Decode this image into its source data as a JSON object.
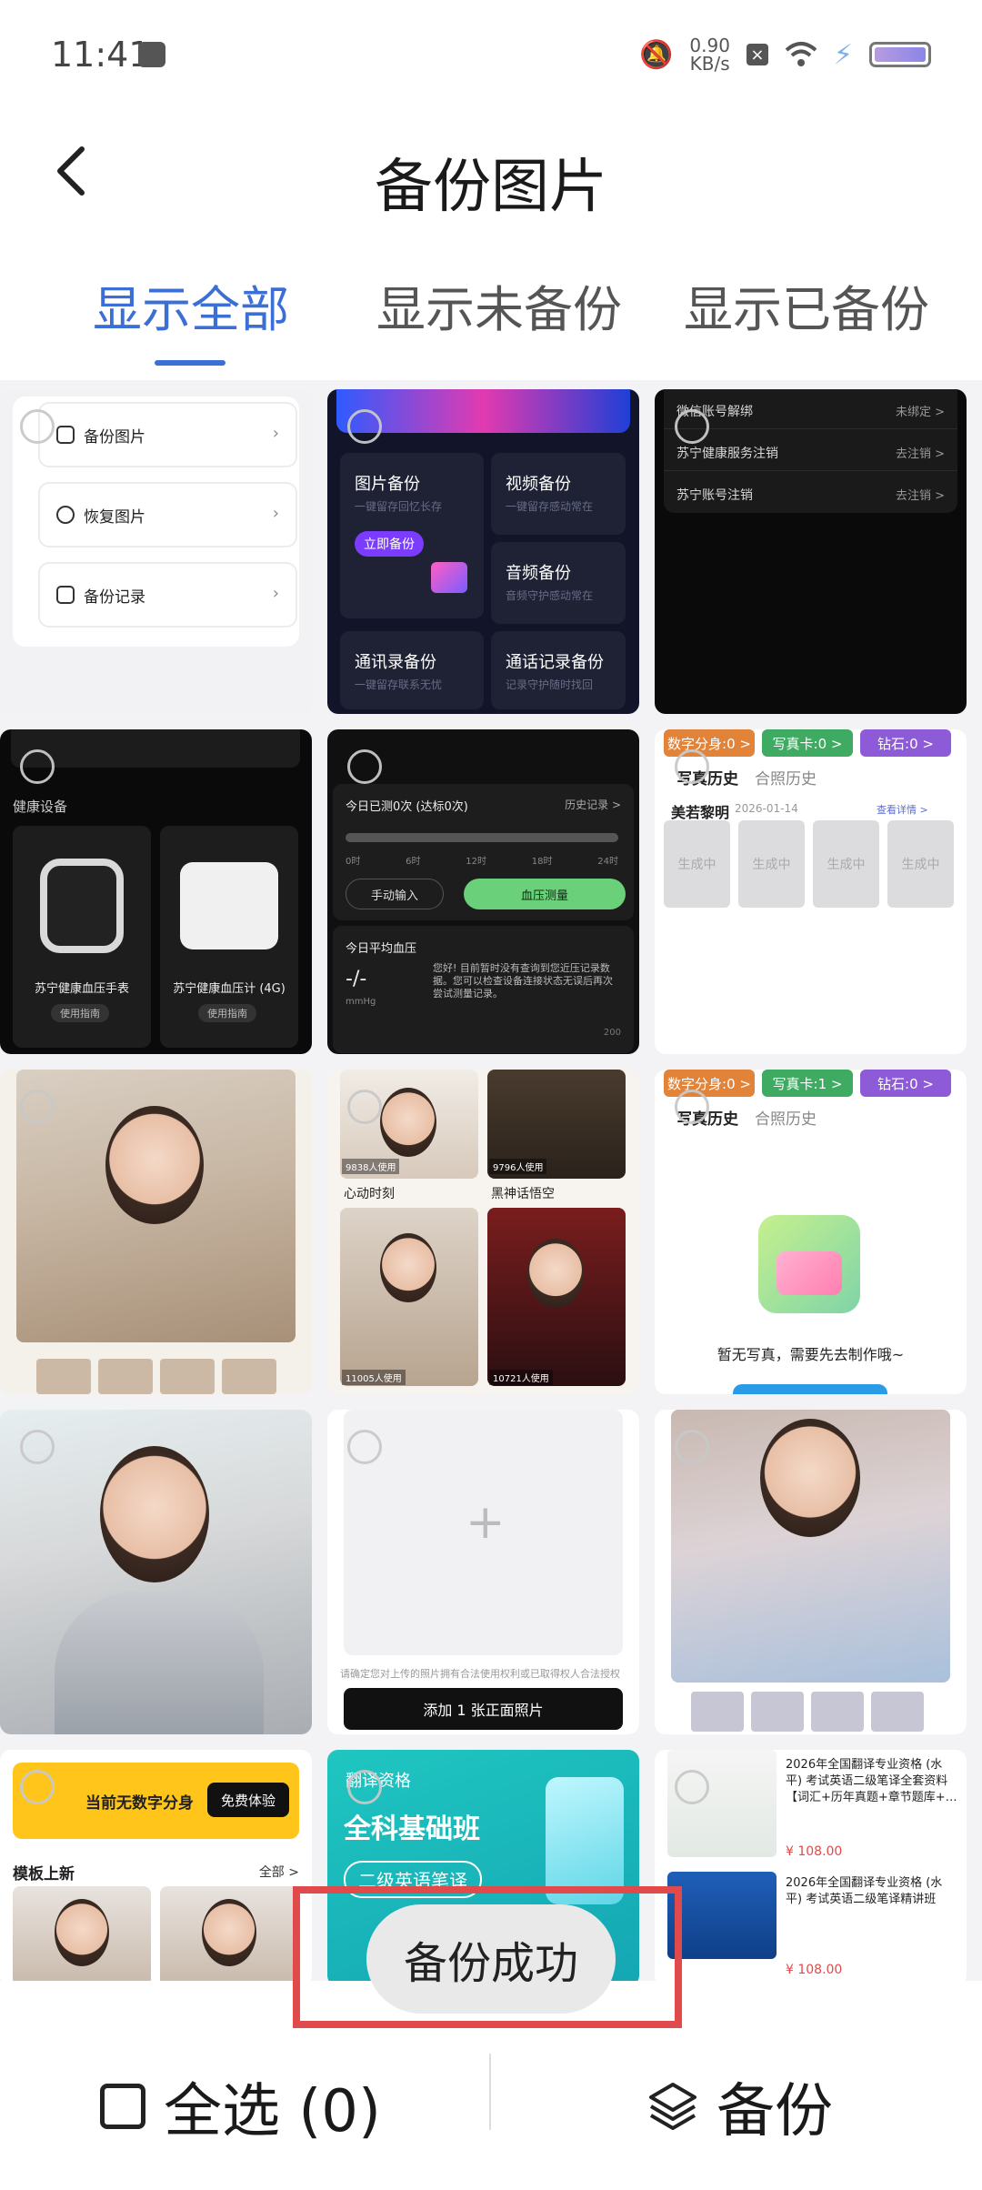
{
  "status_bar": {
    "time": "11:41",
    "speed_value": "0.90",
    "speed_unit": "KB/s"
  },
  "header": {
    "title": "备份图片",
    "back_icon": "chevron-left-icon"
  },
  "tabs": [
    {
      "label": "显示全部",
      "active": true
    },
    {
      "label": "显示未备份",
      "active": false
    },
    {
      "label": "显示已备份",
      "active": false
    }
  ],
  "thumbs": {
    "t1": {
      "items": [
        "备份图片",
        "恢复图片",
        "备份记录"
      ]
    },
    "t2": {
      "cards": [
        {
          "title": "图片备份",
          "sub": "一键留存回忆长存",
          "button": "立即备份"
        },
        {
          "title": "视频备份",
          "sub": "一键留存感动常在"
        },
        {
          "title": "音频备份",
          "sub": "音频守护感动常在"
        },
        {
          "title": "通讯录备份",
          "sub": "一键留存联系无忧"
        },
        {
          "title": "通话记录备份",
          "sub": "记录守护随时找回"
        }
      ]
    },
    "t3": {
      "rows": [
        {
          "label": "微信账号解绑",
          "value": "未绑定 >"
        },
        {
          "label": "苏宁健康服务注销",
          "value": "去注销 >"
        },
        {
          "label": "苏宁账号注销",
          "value": "去注销 >"
        }
      ]
    },
    "t4": {
      "section": "健康设备",
      "devices": [
        {
          "name": "苏宁健康血压手表",
          "guide": "使用指南"
        },
        {
          "name": "苏宁健康血压计 (4G)",
          "guide": "使用指南"
        }
      ]
    },
    "t5": {
      "today": "今日已测0次 (达标0次)",
      "history": "历史记录 >",
      "ticks": [
        "0时",
        "6时",
        "12时",
        "18时",
        "24时"
      ],
      "manual": "手动输入",
      "measure": "血压测量",
      "avg": "今日平均血压",
      "avg_value": "-/-",
      "avg_unit": "mmHg",
      "tip": "您好! 目前暂时没有查询到您近压记录数据。您可以检查设备连接状态无误后再次尝试测量记录。",
      "max": "200"
    },
    "t6": {
      "pills": [
        "数字分身:0 >",
        "写真卡:0 >",
        "钻石:0 >"
      ],
      "tabs": [
        "写真历史",
        "合照历史"
      ],
      "name": "美若黎明",
      "date": "2026-01-14",
      "detail": "查看详情 >",
      "generating": "生成中"
    },
    "t8": {
      "items": [
        {
          "name": "心动时刻",
          "count": "9838人使用"
        },
        {
          "name": "黑神话悟空",
          "count": "9796人使用"
        },
        {
          "name": "",
          "count": "11005人使用"
        },
        {
          "name": "",
          "count": "10721人使用"
        }
      ]
    },
    "t9": {
      "pills": [
        "数字分身:0 >",
        "写真卡:1 >",
        "钻石:0 >"
      ],
      "tabs": [
        "写真历史",
        "合照历史"
      ],
      "empty": "暂无写真，需要先去制作哦~"
    },
    "t11": {
      "notice": "请确定您对上传的照片拥有合法使用权利或已取得权人合法授权",
      "button": "添加 1 张正面照片"
    },
    "t13": {
      "banner": "当前无数字分身",
      "trial": "免费体验",
      "section": "模板上新",
      "all": "全部 >"
    },
    "t14": {
      "tag": "翻译资格",
      "title": "全科基础班",
      "sub": "二级英语笔译"
    },
    "t15": {
      "items": [
        {
          "title": "2026年全国翻译专业资格 (水平) 考试英语二级笔译全套资料【词汇+历年真题+章节题库+…",
          "price": "¥ 108.00"
        },
        {
          "title": "2026年全国翻译专业资格 (水平) 考试英语二级笔译精讲班",
          "price": "¥ 108.00"
        }
      ]
    }
  },
  "toast": "备份成功",
  "bottom_bar": {
    "select_all": "全选 (0)",
    "backup": "备份"
  },
  "colors": {
    "accent": "#3b6fd6",
    "highlight_frame": "#e14a4a"
  }
}
